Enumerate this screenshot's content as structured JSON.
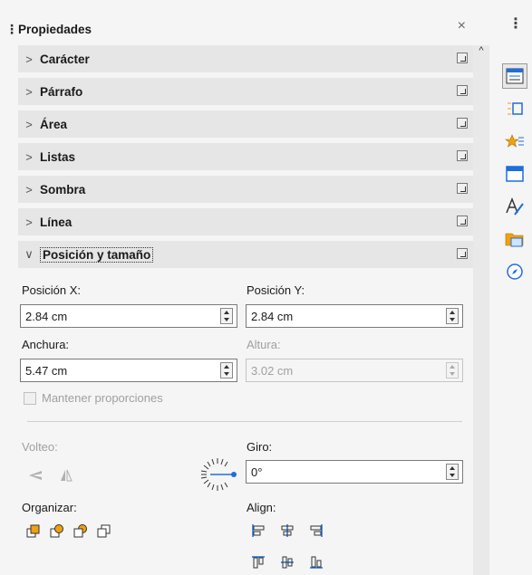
{
  "panel": {
    "title": "Propiedades",
    "close_glyph": "×"
  },
  "sections": [
    {
      "label": "Carácter",
      "expanded": false
    },
    {
      "label": "Párrafo",
      "expanded": false
    },
    {
      "label": "Área",
      "expanded": false
    },
    {
      "label": "Listas",
      "expanded": false
    },
    {
      "label": "Sombra",
      "expanded": false
    },
    {
      "label": "Línea",
      "expanded": false
    },
    {
      "label": "Posición y tamaño",
      "expanded": true
    }
  ],
  "position_size": {
    "pos_x_label": "Posición X:",
    "pos_x_value": "2.84 cm",
    "pos_y_label": "Posición Y:",
    "pos_y_value": "2.84 cm",
    "width_label": "Anchura:",
    "width_value": "5.47 cm",
    "height_label": "Altura:",
    "height_value": "3.02 cm",
    "keep_ratio_label": "Mantener proporciones",
    "flip_label": "Volteo:",
    "rotation_label": "Giro:",
    "rotation_value": "0°",
    "arrange_label": "Organizar:",
    "align_label": "Align:"
  },
  "deck_icons": [
    "properties-icon",
    "styles-icon",
    "gallery-icon",
    "page-icon",
    "style-inspector-icon",
    "navigator-icon"
  ],
  "colors": {
    "accent": "#1e6fd9",
    "orange": "#f0a010"
  }
}
